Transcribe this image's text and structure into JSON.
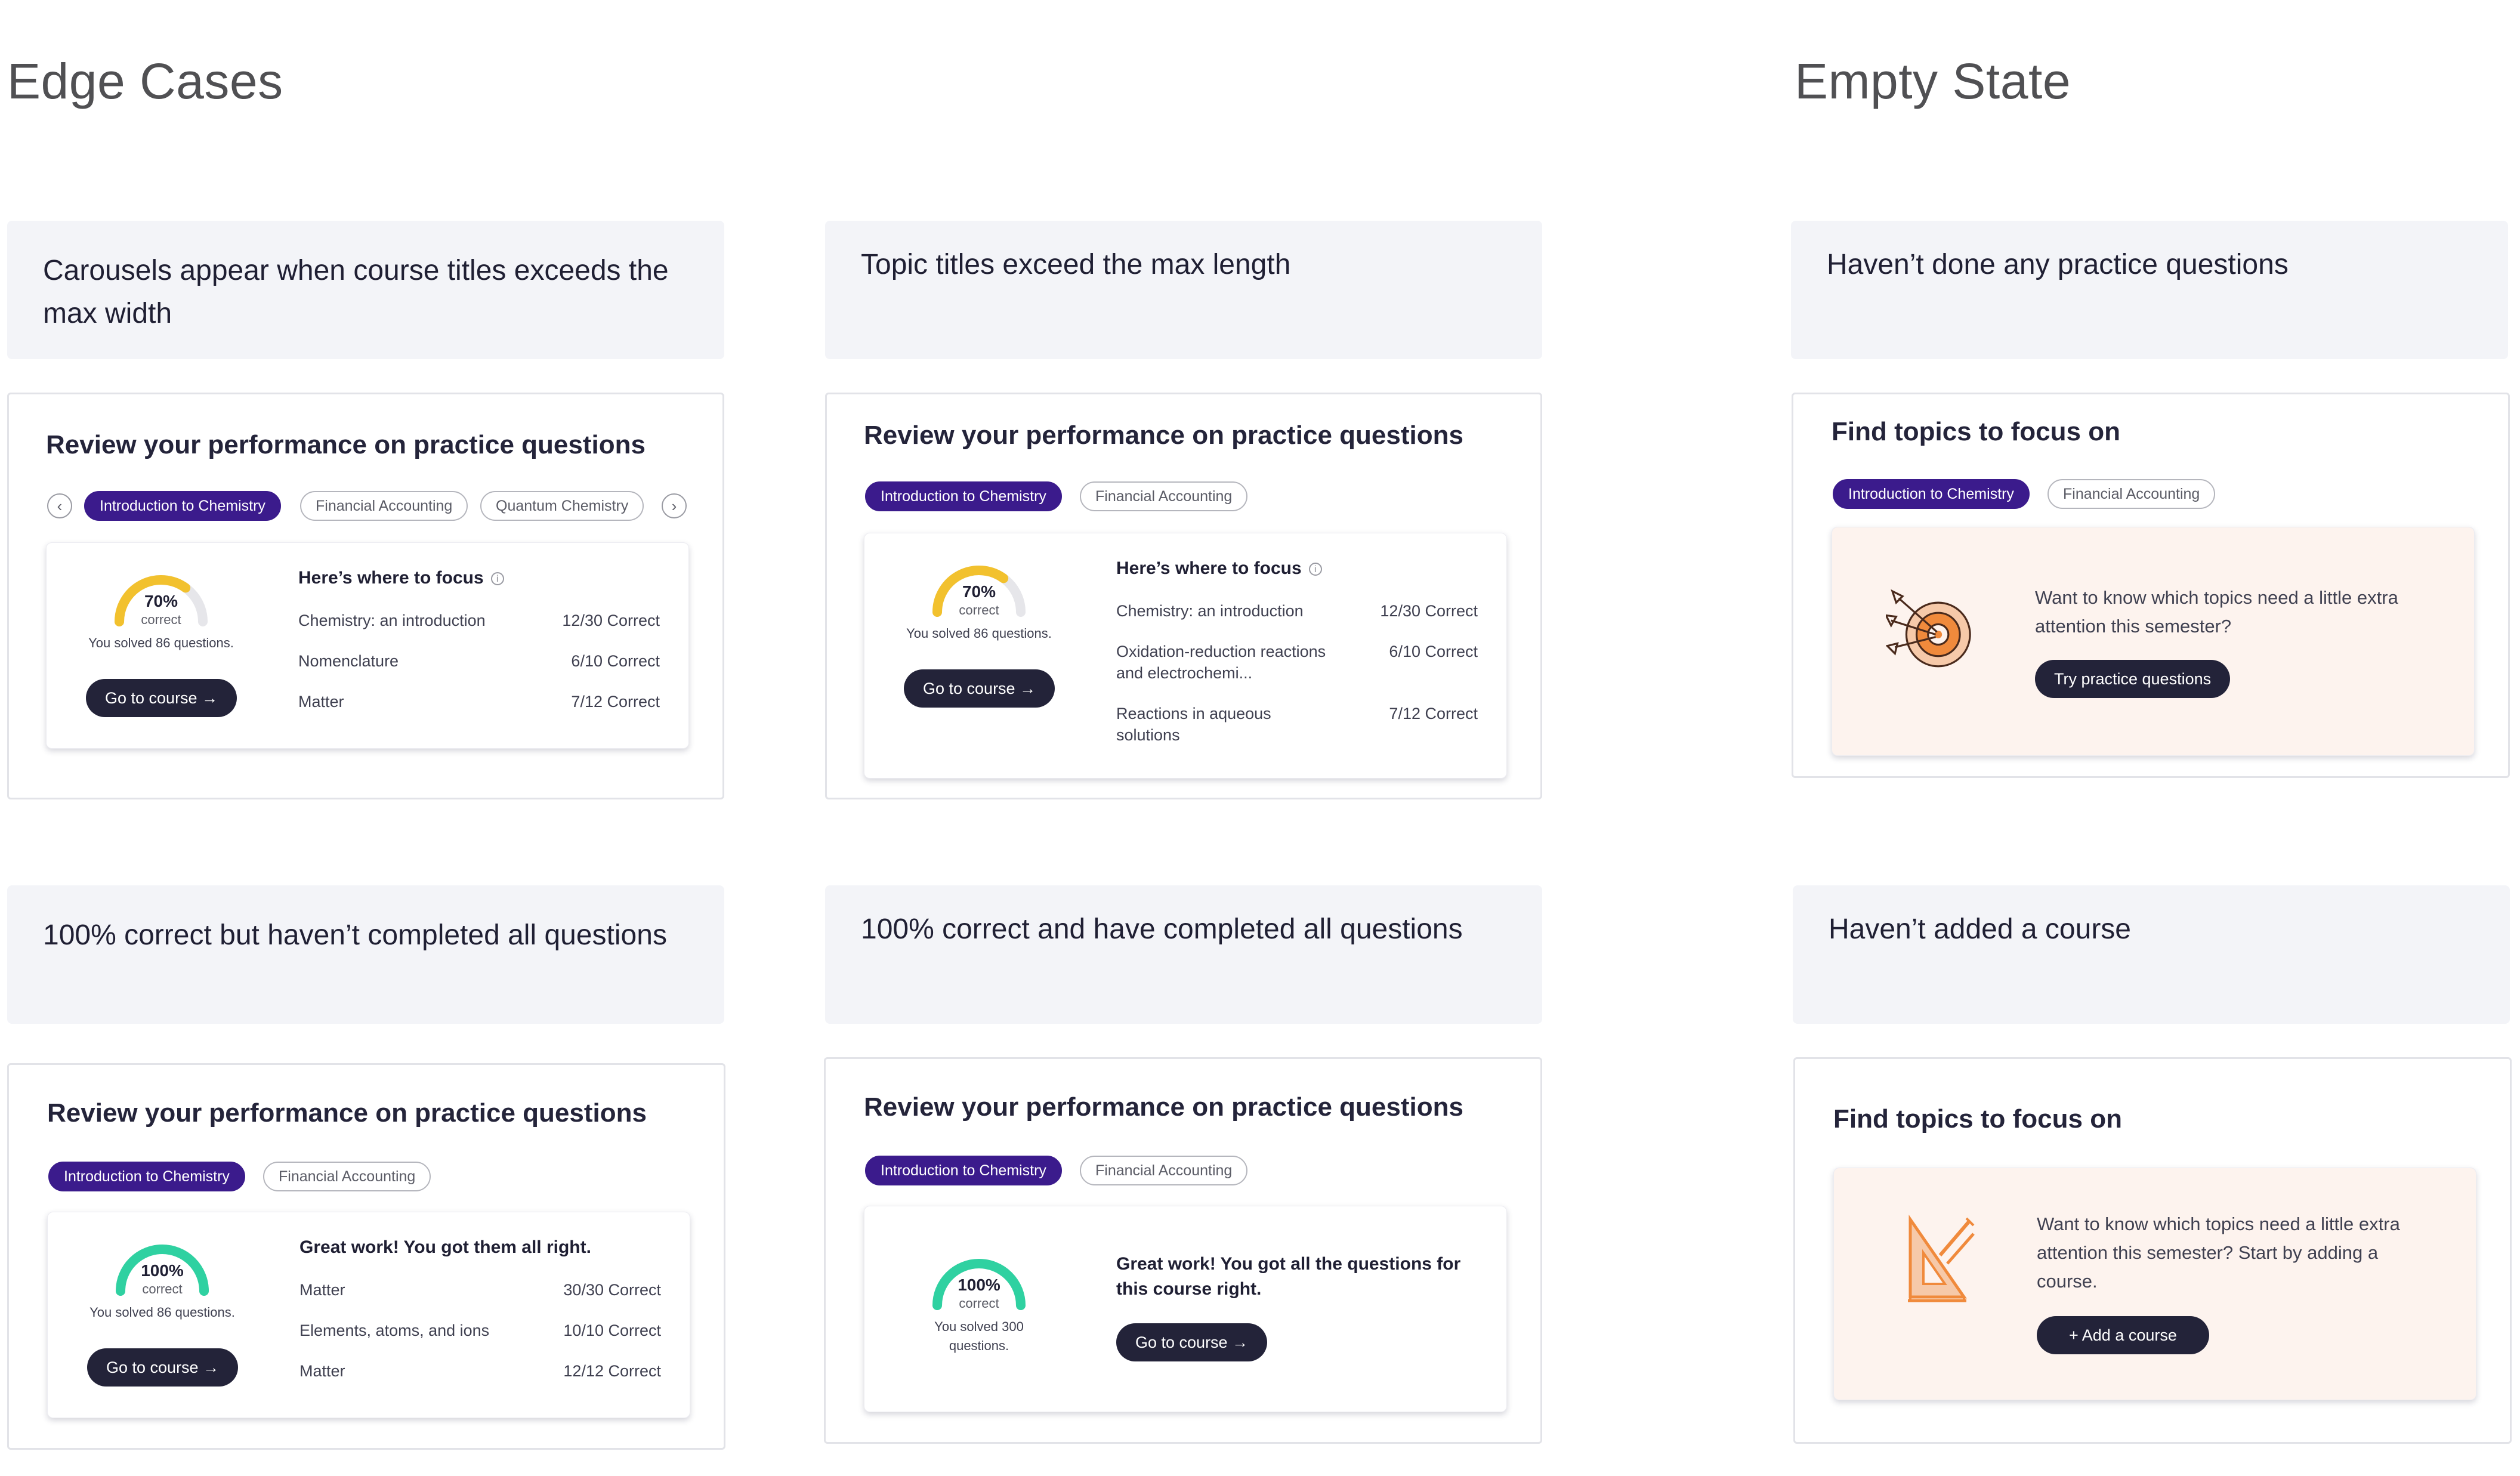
{
  "sections": {
    "edge_cases": "Edge Cases",
    "empty_state": "Empty State"
  },
  "labels": {
    "carousel": "Carousels appear when course titles exceeds the max width",
    "topic_titles": "Topic titles exceed the max length",
    "no_practice": "Haven’t done any practice questions",
    "pct100_incomplete": "100% correct but haven’t completed all questions",
    "pct100_complete": "100% correct and have completed all questions",
    "no_course": "Haven’t added a course"
  },
  "common": {
    "review_title": "Review your performance on practice questions",
    "find_title": "Find topics to focus on",
    "focus_heading": "Here’s where to focus",
    "go_to_course": "Go to course →",
    "correct_word": "correct",
    "course_intro": "Introduction to Chemistry",
    "course_fin": "Financial Accounting",
    "course_quantum": "Quantum Chemistry"
  },
  "card_carousel": {
    "pct": "70%",
    "pct_value": 0.7,
    "solved": "You solved 86 questions.",
    "rows": [
      {
        "name": "Chemistry: an introduction",
        "score": "12/30 Correct"
      },
      {
        "name": "Nomenclature",
        "score": "6/10 Correct"
      },
      {
        "name": "Matter",
        "score": "7/12 Correct"
      }
    ]
  },
  "card_long_topics": {
    "pct": "70%",
    "pct_value": 0.7,
    "solved": "You solved 86 questions.",
    "rows": [
      {
        "name": "Chemistry: an introduction",
        "score": "12/30 Correct"
      },
      {
        "name": "Oxidation-reduction reactions and electrochemi...",
        "score": "6/10 Correct"
      },
      {
        "name": "Reactions in aqueous solutions",
        "score": "7/12 Correct"
      }
    ]
  },
  "card_no_practice": {
    "text": "Want to know which topics need a little extra attention this semester?",
    "button": "Try practice questions"
  },
  "card_100_incomplete": {
    "pct": "100%",
    "pct_value": 1.0,
    "solved": "You solved 86 questions.",
    "heading": "Great work! You got them all right.",
    "rows": [
      {
        "name": "Matter",
        "score": "30/30 Correct"
      },
      {
        "name": "Elements, atoms, and ions",
        "score": "10/10 Correct"
      },
      {
        "name": "Matter",
        "score": "12/12 Correct"
      }
    ]
  },
  "card_100_complete": {
    "pct": "100%",
    "pct_value": 1.0,
    "solved": "You solved 300 questions.",
    "heading": "Great work! You got all the questions for this course right."
  },
  "card_no_course": {
    "text": "Want to know which topics need a little extra attention this semester? Start by adding a course.",
    "button": "+  Add a course"
  },
  "colors": {
    "gauge_yellow": "#f2c12e",
    "gauge_green": "#2fd1a1",
    "gauge_track": "#e6e6ea",
    "pill_active": "#3b1b8c",
    "button_dark": "#232339",
    "empty_card_bg": "#fdf3ee",
    "illustration_orange": "#f08a3c"
  }
}
